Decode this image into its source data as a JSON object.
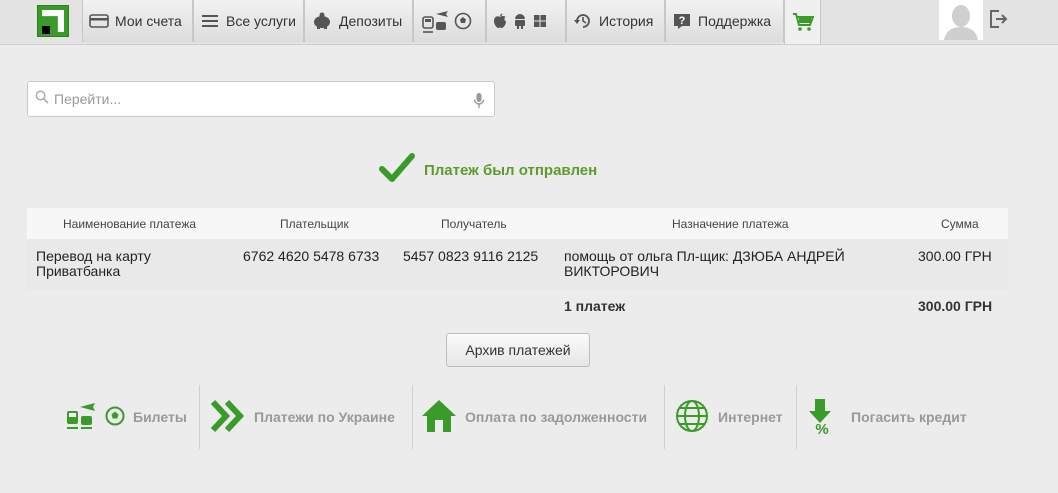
{
  "nav": {
    "accounts_label": "Мои счета",
    "services_label": "Все услуги",
    "deposits_label": "Депозиты",
    "history_label": "История",
    "support_label": "Поддержка"
  },
  "search": {
    "placeholder": "Перейти..."
  },
  "status": {
    "message": "Платеж был отправлен"
  },
  "table": {
    "headers": [
      "Наименование платежа",
      "Плательщик",
      "Получатель",
      "Назначение платежа",
      "Сумма"
    ],
    "row": {
      "name": "Перевод на карту Приватбанка",
      "payer": "6762 4620 5478 6733",
      "recipient": "5457 0823 9116 2125",
      "purpose": "помощь от ольга Пл-щик: ДЗЮБА АНДРЕЙ ВИКТОРОВИЧ",
      "amount": "300.00 ГРН"
    },
    "footer": {
      "count": "1 платеж",
      "total": "300.00 ГРН"
    }
  },
  "archive_button": "Архив платежей",
  "shortcuts": {
    "tickets": "Билеты",
    "ukraine": "Платежи по Украине",
    "debt": "Оплата по задолженности",
    "internet": "Интернет",
    "credit": "Погасить кредит"
  },
  "colors": {
    "accent": "#3a9b2a",
    "success_text": "#5d9b2c",
    "muted": "#999999"
  }
}
